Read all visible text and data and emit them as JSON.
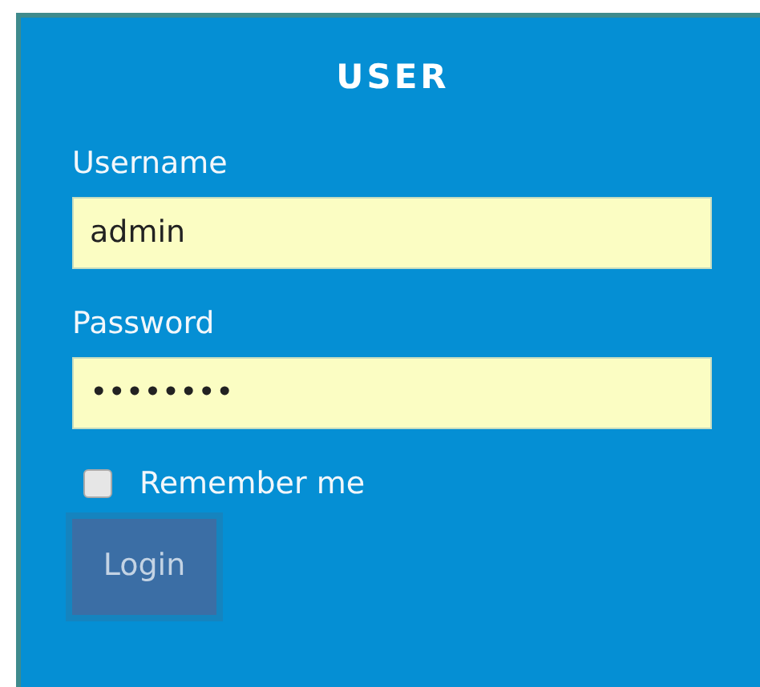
{
  "panel": {
    "title": "USER",
    "fields": [
      {
        "label": "Username",
        "value": "admin"
      },
      {
        "label": "Password",
        "value": "••••••••"
      }
    ],
    "remember": {
      "label": "Remember me",
      "checked": false
    },
    "button": {
      "label": "Login"
    }
  }
}
